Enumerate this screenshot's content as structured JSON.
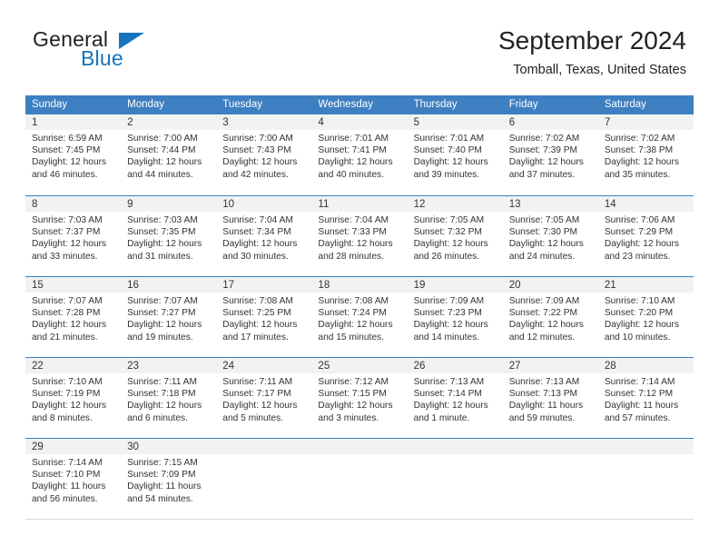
{
  "brand": {
    "name_top": "General",
    "name_bottom": "Blue",
    "accent_color": "#1574bb"
  },
  "header": {
    "title": "September 2024",
    "subtitle": "Tomball, Texas, United States"
  },
  "calendar": {
    "header_color": "#3d7fc1",
    "daynum_band_color": "#f2f2f2",
    "weekdays": [
      "Sunday",
      "Monday",
      "Tuesday",
      "Wednesday",
      "Thursday",
      "Friday",
      "Saturday"
    ],
    "weeks": [
      [
        {
          "day": "1",
          "sunrise": "Sunrise: 6:59 AM",
          "sunset": "Sunset: 7:45 PM",
          "daylight_line1": "Daylight: 12 hours",
          "daylight_line2": "and 46 minutes."
        },
        {
          "day": "2",
          "sunrise": "Sunrise: 7:00 AM",
          "sunset": "Sunset: 7:44 PM",
          "daylight_line1": "Daylight: 12 hours",
          "daylight_line2": "and 44 minutes."
        },
        {
          "day": "3",
          "sunrise": "Sunrise: 7:00 AM",
          "sunset": "Sunset: 7:43 PM",
          "daylight_line1": "Daylight: 12 hours",
          "daylight_line2": "and 42 minutes."
        },
        {
          "day": "4",
          "sunrise": "Sunrise: 7:01 AM",
          "sunset": "Sunset: 7:41 PM",
          "daylight_line1": "Daylight: 12 hours",
          "daylight_line2": "and 40 minutes."
        },
        {
          "day": "5",
          "sunrise": "Sunrise: 7:01 AM",
          "sunset": "Sunset: 7:40 PM",
          "daylight_line1": "Daylight: 12 hours",
          "daylight_line2": "and 39 minutes."
        },
        {
          "day": "6",
          "sunrise": "Sunrise: 7:02 AM",
          "sunset": "Sunset: 7:39 PM",
          "daylight_line1": "Daylight: 12 hours",
          "daylight_line2": "and 37 minutes."
        },
        {
          "day": "7",
          "sunrise": "Sunrise: 7:02 AM",
          "sunset": "Sunset: 7:38 PM",
          "daylight_line1": "Daylight: 12 hours",
          "daylight_line2": "and 35 minutes."
        }
      ],
      [
        {
          "day": "8",
          "sunrise": "Sunrise: 7:03 AM",
          "sunset": "Sunset: 7:37 PM",
          "daylight_line1": "Daylight: 12 hours",
          "daylight_line2": "and 33 minutes."
        },
        {
          "day": "9",
          "sunrise": "Sunrise: 7:03 AM",
          "sunset": "Sunset: 7:35 PM",
          "daylight_line1": "Daylight: 12 hours",
          "daylight_line2": "and 31 minutes."
        },
        {
          "day": "10",
          "sunrise": "Sunrise: 7:04 AM",
          "sunset": "Sunset: 7:34 PM",
          "daylight_line1": "Daylight: 12 hours",
          "daylight_line2": "and 30 minutes."
        },
        {
          "day": "11",
          "sunrise": "Sunrise: 7:04 AM",
          "sunset": "Sunset: 7:33 PM",
          "daylight_line1": "Daylight: 12 hours",
          "daylight_line2": "and 28 minutes."
        },
        {
          "day": "12",
          "sunrise": "Sunrise: 7:05 AM",
          "sunset": "Sunset: 7:32 PM",
          "daylight_line1": "Daylight: 12 hours",
          "daylight_line2": "and 26 minutes."
        },
        {
          "day": "13",
          "sunrise": "Sunrise: 7:05 AM",
          "sunset": "Sunset: 7:30 PM",
          "daylight_line1": "Daylight: 12 hours",
          "daylight_line2": "and 24 minutes."
        },
        {
          "day": "14",
          "sunrise": "Sunrise: 7:06 AM",
          "sunset": "Sunset: 7:29 PM",
          "daylight_line1": "Daylight: 12 hours",
          "daylight_line2": "and 23 minutes."
        }
      ],
      [
        {
          "day": "15",
          "sunrise": "Sunrise: 7:07 AM",
          "sunset": "Sunset: 7:28 PM",
          "daylight_line1": "Daylight: 12 hours",
          "daylight_line2": "and 21 minutes."
        },
        {
          "day": "16",
          "sunrise": "Sunrise: 7:07 AM",
          "sunset": "Sunset: 7:27 PM",
          "daylight_line1": "Daylight: 12 hours",
          "daylight_line2": "and 19 minutes."
        },
        {
          "day": "17",
          "sunrise": "Sunrise: 7:08 AM",
          "sunset": "Sunset: 7:25 PM",
          "daylight_line1": "Daylight: 12 hours",
          "daylight_line2": "and 17 minutes."
        },
        {
          "day": "18",
          "sunrise": "Sunrise: 7:08 AM",
          "sunset": "Sunset: 7:24 PM",
          "daylight_line1": "Daylight: 12 hours",
          "daylight_line2": "and 15 minutes."
        },
        {
          "day": "19",
          "sunrise": "Sunrise: 7:09 AM",
          "sunset": "Sunset: 7:23 PM",
          "daylight_line1": "Daylight: 12 hours",
          "daylight_line2": "and 14 minutes."
        },
        {
          "day": "20",
          "sunrise": "Sunrise: 7:09 AM",
          "sunset": "Sunset: 7:22 PM",
          "daylight_line1": "Daylight: 12 hours",
          "daylight_line2": "and 12 minutes."
        },
        {
          "day": "21",
          "sunrise": "Sunrise: 7:10 AM",
          "sunset": "Sunset: 7:20 PM",
          "daylight_line1": "Daylight: 12 hours",
          "daylight_line2": "and 10 minutes."
        }
      ],
      [
        {
          "day": "22",
          "sunrise": "Sunrise: 7:10 AM",
          "sunset": "Sunset: 7:19 PM",
          "daylight_line1": "Daylight: 12 hours",
          "daylight_line2": "and 8 minutes."
        },
        {
          "day": "23",
          "sunrise": "Sunrise: 7:11 AM",
          "sunset": "Sunset: 7:18 PM",
          "daylight_line1": "Daylight: 12 hours",
          "daylight_line2": "and 6 minutes."
        },
        {
          "day": "24",
          "sunrise": "Sunrise: 7:11 AM",
          "sunset": "Sunset: 7:17 PM",
          "daylight_line1": "Daylight: 12 hours",
          "daylight_line2": "and 5 minutes."
        },
        {
          "day": "25",
          "sunrise": "Sunrise: 7:12 AM",
          "sunset": "Sunset: 7:15 PM",
          "daylight_line1": "Daylight: 12 hours",
          "daylight_line2": "and 3 minutes."
        },
        {
          "day": "26",
          "sunrise": "Sunrise: 7:13 AM",
          "sunset": "Sunset: 7:14 PM",
          "daylight_line1": "Daylight: 12 hours",
          "daylight_line2": "and 1 minute."
        },
        {
          "day": "27",
          "sunrise": "Sunrise: 7:13 AM",
          "sunset": "Sunset: 7:13 PM",
          "daylight_line1": "Daylight: 11 hours",
          "daylight_line2": "and 59 minutes."
        },
        {
          "day": "28",
          "sunrise": "Sunrise: 7:14 AM",
          "sunset": "Sunset: 7:12 PM",
          "daylight_line1": "Daylight: 11 hours",
          "daylight_line2": "and 57 minutes."
        }
      ],
      [
        {
          "day": "29",
          "sunrise": "Sunrise: 7:14 AM",
          "sunset": "Sunset: 7:10 PM",
          "daylight_line1": "Daylight: 11 hours",
          "daylight_line2": "and 56 minutes."
        },
        {
          "day": "30",
          "sunrise": "Sunrise: 7:15 AM",
          "sunset": "Sunset: 7:09 PM",
          "daylight_line1": "Daylight: 11 hours",
          "daylight_line2": "and 54 minutes."
        },
        {
          "day": "",
          "sunrise": "",
          "sunset": "",
          "daylight_line1": "",
          "daylight_line2": ""
        },
        {
          "day": "",
          "sunrise": "",
          "sunset": "",
          "daylight_line1": "",
          "daylight_line2": ""
        },
        {
          "day": "",
          "sunrise": "",
          "sunset": "",
          "daylight_line1": "",
          "daylight_line2": ""
        },
        {
          "day": "",
          "sunrise": "",
          "sunset": "",
          "daylight_line1": "",
          "daylight_line2": ""
        },
        {
          "day": "",
          "sunrise": "",
          "sunset": "",
          "daylight_line1": "",
          "daylight_line2": ""
        }
      ]
    ]
  }
}
